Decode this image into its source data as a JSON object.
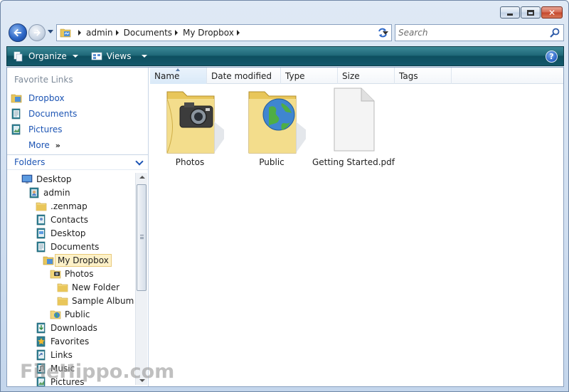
{
  "window": {
    "close_glyph": "✕"
  },
  "address": {
    "crumbs": [
      "admin",
      "Documents",
      "My Dropbox"
    ]
  },
  "search": {
    "placeholder": "Search"
  },
  "toolbar": {
    "organize_label": "Organize",
    "views_label": "Views",
    "help_label": "?"
  },
  "favorites": {
    "header": "Favorite Links",
    "items": [
      {
        "label": "Dropbox",
        "icon": "dropbox-folder-icon"
      },
      {
        "label": "Documents",
        "icon": "documents-icon"
      },
      {
        "label": "Pictures",
        "icon": "pictures-icon"
      }
    ],
    "more_label": "More",
    "more_glyph": "»"
  },
  "folders": {
    "header": "Folders",
    "tree": [
      {
        "label": "Desktop",
        "icon": "desktop-icon"
      },
      {
        "label": "admin",
        "icon": "user-folder-icon"
      },
      {
        "label": ".zenmap",
        "icon": "folder-icon"
      },
      {
        "label": "Contacts",
        "icon": "contacts-icon"
      },
      {
        "label": "Desktop",
        "icon": "desktop-folder-icon"
      },
      {
        "label": "Documents",
        "icon": "documents-icon"
      },
      {
        "label": "My Dropbox",
        "icon": "dropbox-folder-icon",
        "selected": true
      },
      {
        "label": "Photos",
        "icon": "photos-folder-icon"
      },
      {
        "label": "New Folder",
        "icon": "folder-icon"
      },
      {
        "label": "Sample Album",
        "icon": "folder-icon"
      },
      {
        "label": "Public",
        "icon": "public-folder-icon"
      },
      {
        "label": "Downloads",
        "icon": "downloads-icon"
      },
      {
        "label": "Favorites",
        "icon": "favorites-icon"
      },
      {
        "label": "Links",
        "icon": "links-icon"
      },
      {
        "label": "Music",
        "icon": "music-icon"
      },
      {
        "label": "Pictures",
        "icon": "pictures-icon"
      }
    ]
  },
  "columns": [
    "Name",
    "Date modified",
    "Type",
    "Size",
    "Tags"
  ],
  "files": [
    {
      "name": "Photos",
      "icon": "photos-folder-icon"
    },
    {
      "name": "Public",
      "icon": "public-folder-icon"
    },
    {
      "name": "Getting Started.pdf",
      "icon": "pdf-document-icon"
    }
  ],
  "watermark": "FileHippo.com",
  "colors": {
    "accent_link": "#1d55b4",
    "command_bar": "#1f6878",
    "selection": "#fdf1c8"
  }
}
